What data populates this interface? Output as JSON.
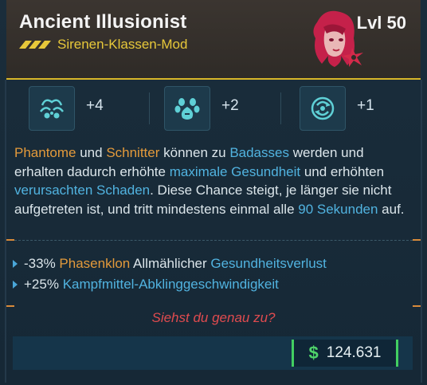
{
  "header": {
    "title": "Ancient Illusionist",
    "level": "Lvl 50",
    "subtitle": "Sirenen-Klassen-Mod"
  },
  "stats": [
    {
      "icon": "phantom-icon",
      "value": "+4"
    },
    {
      "icon": "paw-icon",
      "value": "+2"
    },
    {
      "icon": "cycle-icon",
      "value": "+1"
    }
  ],
  "description": {
    "p1": "Phantome",
    "p2": " und ",
    "p3": "Schnitter",
    "p4": " können zu ",
    "p5": "Badasses",
    "p6": " werden und erhalten dadurch erhöhte ",
    "p7": "maximale Gesundheit",
    "p8": " und erhöhten ",
    "p9": "verursachten Schaden",
    "p10": ". Diese Chance steigt, je länger sie nicht aufgetreten ist, und tritt mindestens einmal alle ",
    "p11": "90 Sekunden",
    "p12": " auf."
  },
  "bullets": {
    "b1_prefix": "-33% ",
    "b1_orange": "Phasenklon",
    "b1_mid": " Allmählicher ",
    "b1_blue": "Gesundheitsverlust",
    "b2_prefix": "+25% ",
    "b2_blue": "Kampfmittel-Abklinggeschwindigkeit"
  },
  "flavor": "Siehst du genau zu?",
  "price": {
    "currency": "$",
    "value": "124.631"
  },
  "colors": {
    "accent_yellow": "#d8b629",
    "orange": "#e39a3b",
    "blue": "#51b3e0",
    "flavor_red": "#e04b4f",
    "money_green": "#42cf61"
  }
}
